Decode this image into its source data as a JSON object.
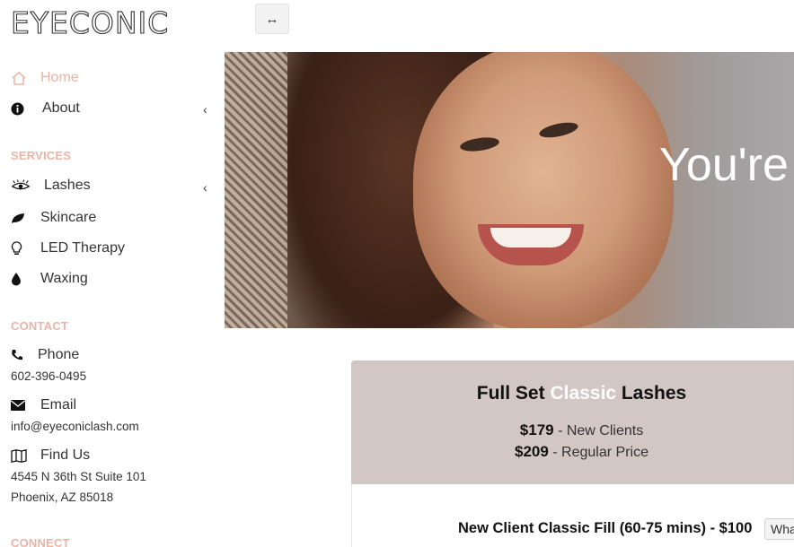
{
  "brand": {
    "logo": "EYECONIC"
  },
  "toolbar": {
    "toggle_icon": "↔"
  },
  "sidebar": {
    "nav": [
      {
        "label": "Home",
        "icon": "home-icon"
      },
      {
        "label": "About",
        "icon": "info-icon"
      }
    ],
    "services_heading": "SERVICES",
    "services": [
      {
        "label": "Lashes",
        "icon": "eye-icon"
      },
      {
        "label": "Skincare",
        "icon": "leaf-icon"
      },
      {
        "label": "LED Therapy",
        "icon": "lightbulb-icon"
      },
      {
        "label": "Waxing",
        "icon": "drop-icon"
      }
    ],
    "contact_heading": "CONTACT",
    "contact": {
      "phone_label": "Phone",
      "phone_value": "602-396-0495",
      "email_label": "Email",
      "email_value": "info@eyeconiclash.com",
      "find_label": "Find Us",
      "address_line1": "4545 N 36th St Suite 101",
      "address_line2": "Phoenix, AZ 85018"
    },
    "connect_heading": "CONNECT"
  },
  "hero": {
    "text": "You're"
  },
  "pricing": {
    "title_pre": "Full Set ",
    "title_highlight": "Classic",
    "title_post": " Lashes",
    "price1": "$179",
    "price1_desc": " - New Clients",
    "price2": "$209",
    "price2_desc": " - Regular Price",
    "service_line": "New Client Classic Fill (60-75 mins) - $100",
    "what_button": "What"
  },
  "colors": {
    "accent": "#e8b5a6",
    "card_bg": "#d2c7c4"
  }
}
